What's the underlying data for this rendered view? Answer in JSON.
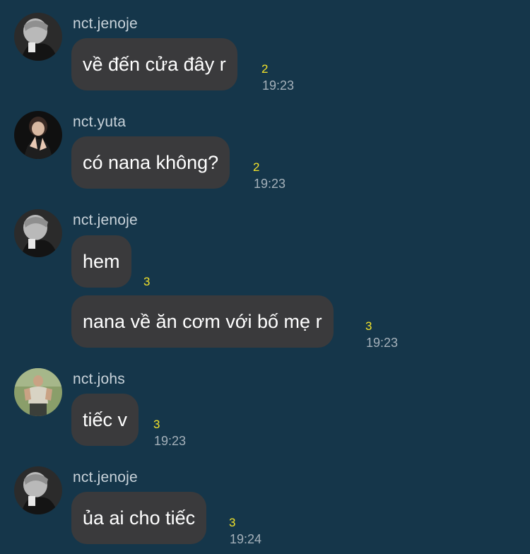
{
  "colors": {
    "background": "#15364a",
    "bubble": "#3a3a3c",
    "unread": "#f2e22a",
    "meta": "#a5b1ba",
    "username": "#c9d3da"
  },
  "messages": [
    {
      "sender": "nct.jenoje",
      "text": "về đến cửa đây r",
      "unread": "2",
      "time": "19:23"
    },
    {
      "sender": "nct.yuta",
      "text": "có nana không?",
      "unread": "2",
      "time": "19:23"
    },
    {
      "sender": "nct.jenoje",
      "text": "hem",
      "unread": "3",
      "time": ""
    },
    {
      "sender": "",
      "text": "nana về ăn cơm với bố mẹ r",
      "unread": "3",
      "time": "19:23"
    },
    {
      "sender": "nct.johs",
      "text": "tiếc v",
      "unread": "3",
      "time": "19:23"
    },
    {
      "sender": "nct.jenoje",
      "text": "ủa ai cho tiếc",
      "unread": "3",
      "time": "19:24"
    }
  ]
}
